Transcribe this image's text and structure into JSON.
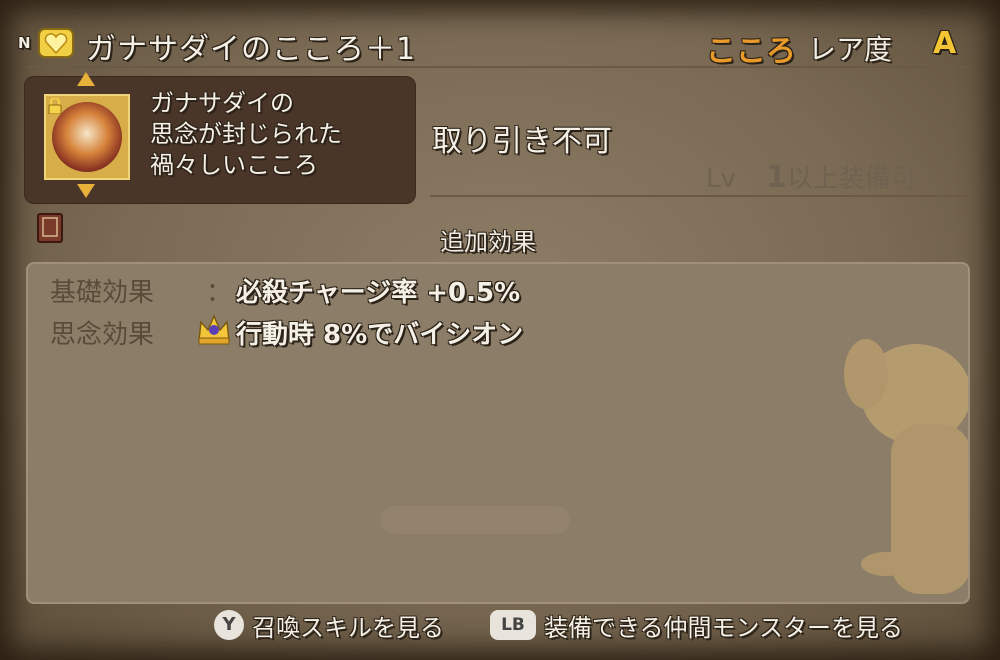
{
  "header": {
    "n_badge": "N",
    "title": "ガナサダイのこころ＋1",
    "kokoro_label": "こころ",
    "rarity_label": "レア度",
    "rarity_value": "A"
  },
  "item": {
    "description_lines": [
      "ガナサダイの",
      "思念が封じられた",
      "禍々しいこころ"
    ],
    "trade_status": "取り引き不可",
    "level_prefix": "Lv",
    "level_value": "1",
    "level_suffix": "以上装備可"
  },
  "extra": {
    "title": "追加効果",
    "effects": [
      {
        "label": "基礎効果",
        "separator": "：",
        "value": "必殺チャージ率 +0.5%"
      },
      {
        "label": "思念効果",
        "separator": "",
        "value": "行動時 8%でバイシオン"
      }
    ]
  },
  "footer": {
    "y_button": "Y",
    "y_label": "召喚スキルを見る",
    "lb_button": "LB",
    "lb_label": "装備できる仲間モンスターを見る"
  },
  "colors": {
    "kokoro": "#e89a2b",
    "rarity": "#f3c532",
    "panel": "#8c7d68"
  },
  "icons": [
    "heart-icon",
    "lock-icon",
    "book-icon",
    "crown-icon"
  ]
}
